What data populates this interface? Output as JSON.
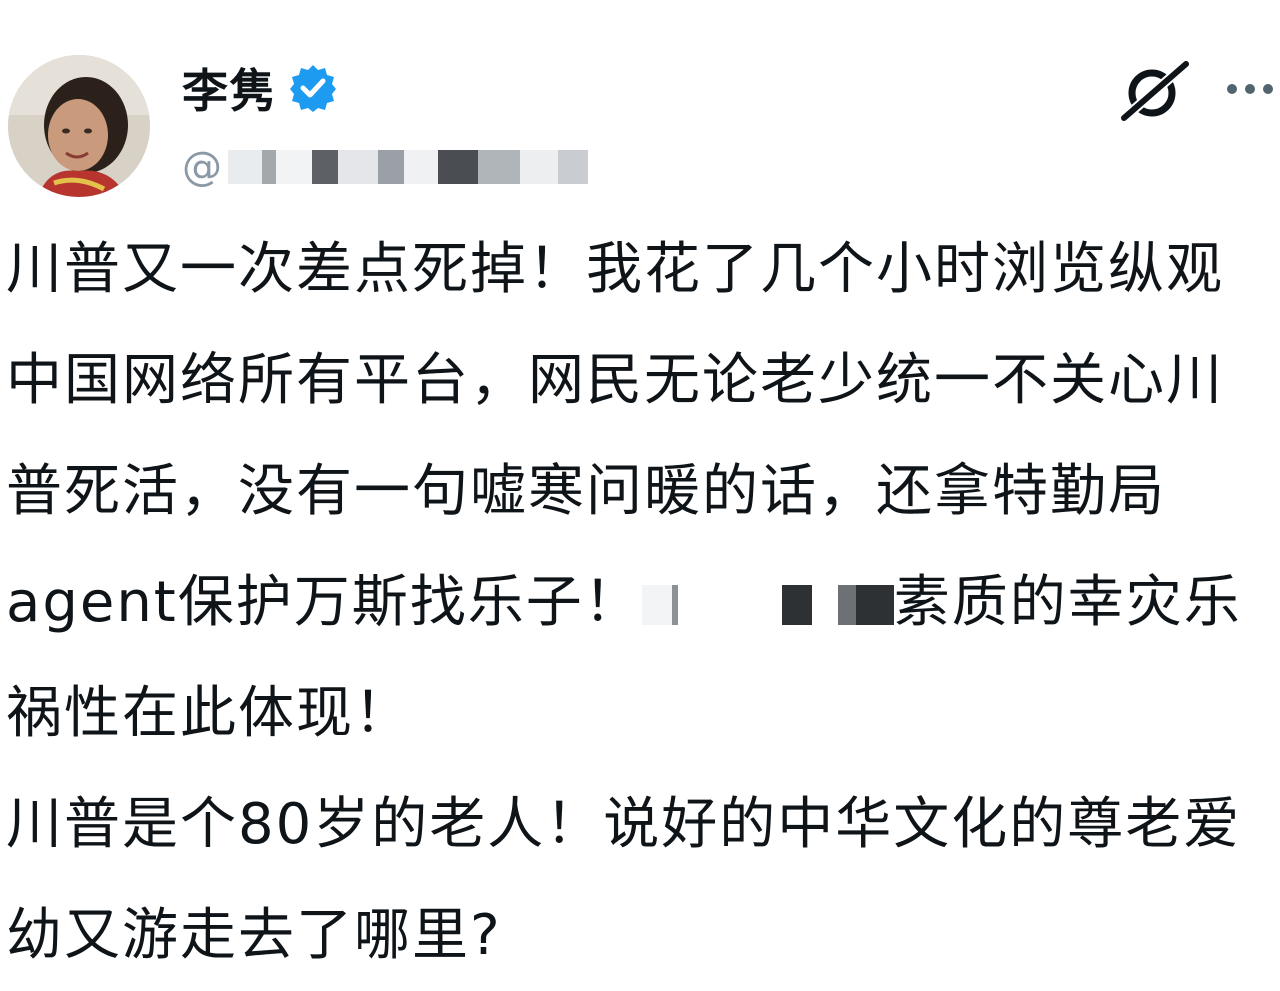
{
  "author": {
    "display_name": "李隽",
    "handle_prefix": "@",
    "verified": true,
    "avatar_icon": "user-avatar-photo",
    "verified_icon": "verified-badge-icon",
    "accent_color": "#1d9bf0"
  },
  "header_actions": {
    "grok_icon": "grok-icon",
    "more_icon": "more-options-icon"
  },
  "tweet": {
    "paragraphs": [
      {
        "before": "川普又一次差点死掉！我花了几个小时浏览纵观中国网络所有平台，网民无论老少统一不关心川普死活，没有一句嘘寒问暖的话，还拿特勤局agent保护万斯找乐子！",
        "after": "素质的幸灾乐祸性在此体现！"
      },
      {
        "text": "川普是个80岁的老人！说好的中华文化的尊老爱幼又游走去了哪里?"
      }
    ]
  }
}
